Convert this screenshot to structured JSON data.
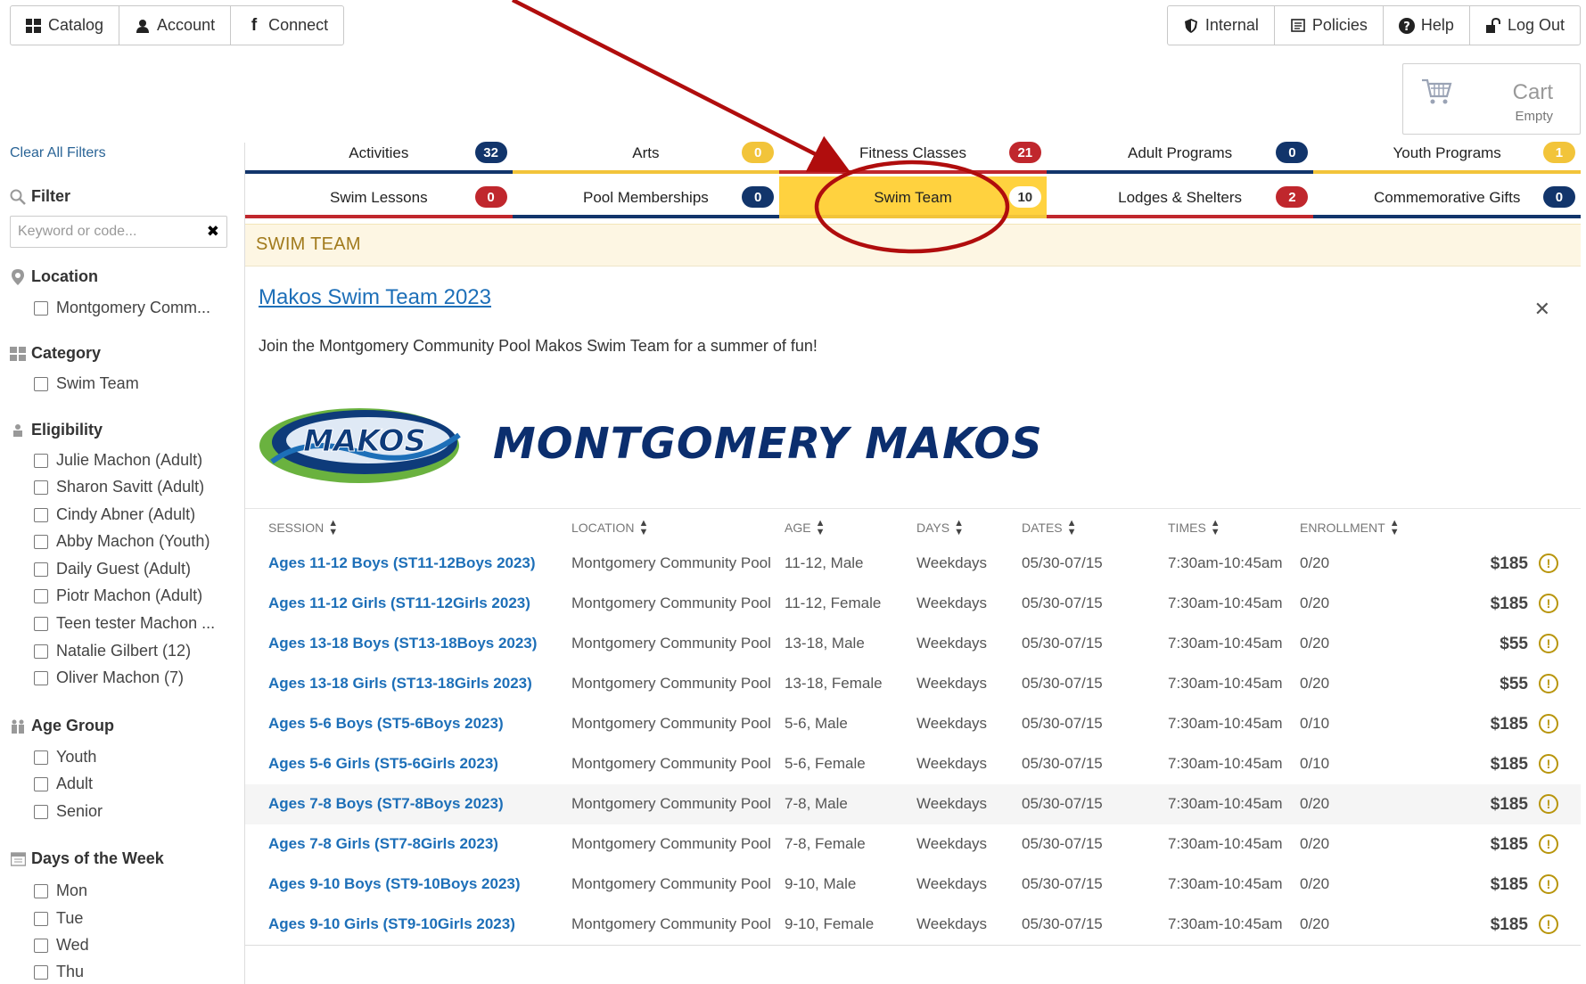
{
  "nav": {
    "left": [
      {
        "label": "Catalog",
        "icon": "grid-icon"
      },
      {
        "label": "Account",
        "icon": "user-icon"
      },
      {
        "label": "Connect",
        "icon": "facebook-icon"
      }
    ],
    "right": [
      {
        "label": "Internal",
        "icon": "shield-icon"
      },
      {
        "label": "Policies",
        "icon": "document-icon"
      },
      {
        "label": "Help",
        "icon": "question-icon"
      },
      {
        "label": "Log Out",
        "icon": "unlock-icon"
      }
    ]
  },
  "cart": {
    "title": "Cart",
    "status": "Empty"
  },
  "sidebar": {
    "clear_filters": "Clear All Filters",
    "filter_label": "Filter",
    "keyword_placeholder": "Keyword or code...",
    "location": {
      "label": "Location",
      "options": [
        "Montgomery Comm..."
      ]
    },
    "category": {
      "label": "Category",
      "options": [
        "Swim Team"
      ]
    },
    "eligibility": {
      "label": "Eligibility",
      "options": [
        "Julie Machon (Adult)",
        "Sharon Savitt (Adult)",
        "Cindy Abner (Adult)",
        "Abby Machon (Youth)",
        "Daily Guest (Adult)",
        "Piotr Machon (Adult)",
        "Teen tester Machon ...",
        "Natalie Gilbert (12)",
        "Oliver Machon (7)"
      ]
    },
    "age_group": {
      "label": "Age Group",
      "options": [
        "Youth",
        "Adult",
        "Senior"
      ]
    },
    "days": {
      "label": "Days of the Week",
      "options": [
        "Mon",
        "Tue",
        "Wed",
        "Thu"
      ]
    }
  },
  "tabs": {
    "row1": [
      {
        "label": "Activities",
        "count": "32",
        "color": "#12356b"
      },
      {
        "label": "Arts",
        "count": "0",
        "color": "#f2c43a"
      },
      {
        "label": "Fitness Classes",
        "count": "21",
        "color": "#c0272d"
      },
      {
        "label": "Adult Programs",
        "count": "0",
        "color": "#12356b"
      },
      {
        "label": "Youth Programs",
        "count": "1",
        "color": "#f2c43a"
      }
    ],
    "row2": [
      {
        "label": "Swim Lessons",
        "count": "0",
        "color": "#c0272d"
      },
      {
        "label": "Pool Memberships",
        "count": "0",
        "color": "#12356b"
      },
      {
        "label": "Swim Team",
        "count": "10",
        "color": "#f2c43a",
        "active": true
      },
      {
        "label": "Lodges & Shelters",
        "count": "2",
        "color": "#c0272d"
      },
      {
        "label": "Commemorative Gifts",
        "count": "0",
        "color": "#12356b"
      }
    ]
  },
  "panel": {
    "heading": "SWIM TEAM",
    "program_title": "Makos Swim Team 2023",
    "description": "Join the Montgomery Community Pool Makos Swim Team for a summer of fun!",
    "logo_text": "MONTGOMERY MAKOS",
    "logo_badge": "MAKOS"
  },
  "table": {
    "columns": [
      "SESSION",
      "LOCATION",
      "AGE",
      "DAYS",
      "DATES",
      "TIMES",
      "ENROLLMENT"
    ],
    "rows": [
      {
        "session": "Ages 11-12 Boys (ST11-12Boys 2023)",
        "location": "Montgomery Community Pool",
        "age": "11-12, Male",
        "days": "Weekdays",
        "dates": "05/30-07/15",
        "times": "7:30am-10:45am",
        "enrollment": "0/20",
        "price": "$185"
      },
      {
        "session": "Ages 11-12 Girls (ST11-12Girls 2023)",
        "location": "Montgomery Community Pool",
        "age": "11-12, Female",
        "days": "Weekdays",
        "dates": "05/30-07/15",
        "times": "7:30am-10:45am",
        "enrollment": "0/20",
        "price": "$185"
      },
      {
        "session": "Ages 13-18 Boys (ST13-18Boys 2023)",
        "location": "Montgomery Community Pool",
        "age": "13-18, Male",
        "days": "Weekdays",
        "dates": "05/30-07/15",
        "times": "7:30am-10:45am",
        "enrollment": "0/20",
        "price": "$55"
      },
      {
        "session": "Ages 13-18 Girls (ST13-18Girls 2023)",
        "location": "Montgomery Community Pool",
        "age": "13-18, Female",
        "days": "Weekdays",
        "dates": "05/30-07/15",
        "times": "7:30am-10:45am",
        "enrollment": "0/20",
        "price": "$55"
      },
      {
        "session": "Ages 5-6 Boys (ST5-6Boys 2023)",
        "location": "Montgomery Community Pool",
        "age": "5-6, Male",
        "days": "Weekdays",
        "dates": "05/30-07/15",
        "times": "7:30am-10:45am",
        "enrollment": "0/10",
        "price": "$185"
      },
      {
        "session": "Ages 5-6 Girls (ST5-6Girls 2023)",
        "location": "Montgomery Community Pool",
        "age": "5-6, Female",
        "days": "Weekdays",
        "dates": "05/30-07/15",
        "times": "7:30am-10:45am",
        "enrollment": "0/10",
        "price": "$185"
      },
      {
        "session": "Ages 7-8 Boys (ST7-8Boys 2023)",
        "location": "Montgomery Community Pool",
        "age": "7-8, Male",
        "days": "Weekdays",
        "dates": "05/30-07/15",
        "times": "7:30am-10:45am",
        "enrollment": "0/20",
        "price": "$185"
      },
      {
        "session": "Ages 7-8 Girls (ST7-8Girls 2023)",
        "location": "Montgomery Community Pool",
        "age": "7-8, Female",
        "days": "Weekdays",
        "dates": "05/30-07/15",
        "times": "7:30am-10:45am",
        "enrollment": "0/20",
        "price": "$185"
      },
      {
        "session": "Ages 9-10 Boys (ST9-10Boys 2023)",
        "location": "Montgomery Community Pool",
        "age": "9-10, Male",
        "days": "Weekdays",
        "dates": "05/30-07/15",
        "times": "7:30am-10:45am",
        "enrollment": "0/20",
        "price": "$185"
      },
      {
        "session": "Ages 9-10 Girls (ST9-10Girls 2023)",
        "location": "Montgomery Community Pool",
        "age": "9-10, Female",
        "days": "Weekdays",
        "dates": "05/30-07/15",
        "times": "7:30am-10:45am",
        "enrollment": "0/20",
        "price": "$185"
      }
    ]
  },
  "colors": {
    "navy": "#12356b",
    "gold": "#f2c43a",
    "red": "#c0272d",
    "active_tab": "#ffd23f",
    "annotation": "#b00d0d",
    "link": "#1d6fb8"
  }
}
